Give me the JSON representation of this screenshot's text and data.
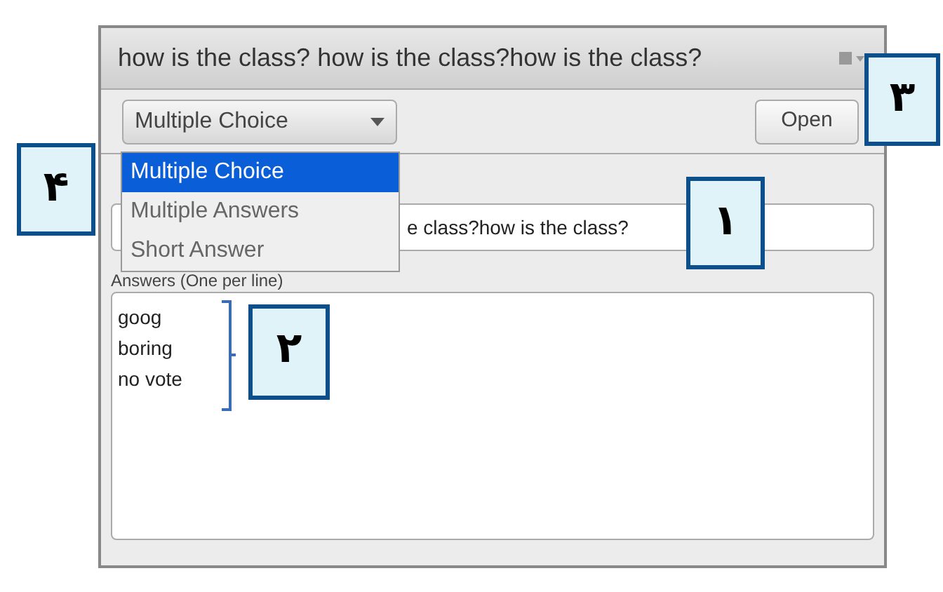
{
  "window": {
    "title": "how is the class? how is the class?how is the class?"
  },
  "toolbar": {
    "question_type": "Multiple Choice",
    "open_button": "Open"
  },
  "question_type_menu": [
    {
      "label": "Multiple Choice",
      "selected": true
    },
    {
      "label": "Multiple Answers",
      "selected": false
    },
    {
      "label": "Short Answer",
      "selected": false
    }
  ],
  "question_field": {
    "value": "e class?how is the class?"
  },
  "answers": {
    "label": "Answers (One per line)",
    "lines": [
      "goog",
      "boring",
      "no vote"
    ]
  },
  "callouts": [
    {
      "number": "۱"
    },
    {
      "number": "۲"
    },
    {
      "number": "۳"
    },
    {
      "number": "۴"
    }
  ]
}
